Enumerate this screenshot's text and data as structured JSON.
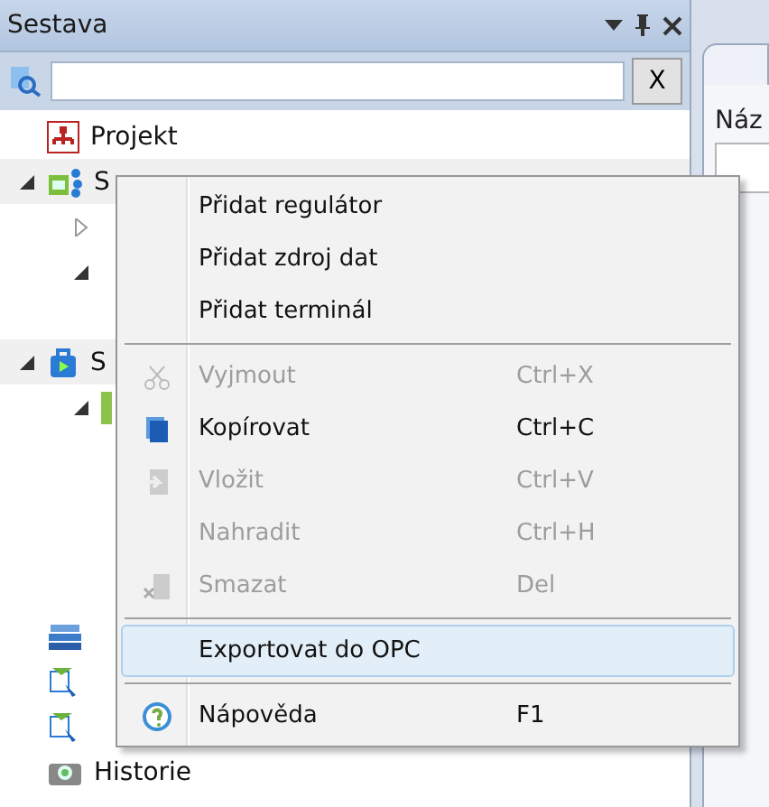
{
  "panel": {
    "title": "Sestava",
    "search": {
      "clear_button": "X"
    },
    "tree": [
      {
        "label": "Projekt"
      },
      {
        "label": "S",
        "expanded": true,
        "children": [
          {
            "expanded": false
          },
          {
            "expanded": true
          }
        ]
      },
      {
        "label": "S",
        "expanded": true,
        "children": [
          {
            "expanded": true
          }
        ]
      },
      {
        "kind": "node"
      },
      {
        "kind": "node"
      },
      {
        "kind": "node"
      },
      {
        "label": "Historie"
      }
    ]
  },
  "document": {
    "field_label": "Náz"
  },
  "context_menu": [
    {
      "kind": "item",
      "label": "Přidat regulátor",
      "disabled": false,
      "selected": false
    },
    {
      "kind": "item",
      "label": "Přidat zdroj dat",
      "disabled": false,
      "selected": false
    },
    {
      "kind": "item",
      "label": "Přidat terminál",
      "disabled": false,
      "selected": false
    },
    {
      "kind": "separator"
    },
    {
      "kind": "item",
      "label": "Vyjmout",
      "shortcut": "Ctrl+X",
      "disabled": true,
      "selected": false
    },
    {
      "kind": "item",
      "label": "Kopírovat",
      "shortcut": "Ctrl+C",
      "disabled": false,
      "selected": false
    },
    {
      "kind": "item",
      "label": "Vložit",
      "shortcut": "Ctrl+V",
      "disabled": true,
      "selected": false
    },
    {
      "kind": "item",
      "label": "Nahradit",
      "shortcut": "Ctrl+H",
      "disabled": true,
      "selected": false
    },
    {
      "kind": "item",
      "label": "Smazat",
      "shortcut": "Del",
      "disabled": true,
      "selected": false
    },
    {
      "kind": "separator"
    },
    {
      "kind": "item",
      "label": "Exportovat do OPC",
      "disabled": false,
      "selected": true
    },
    {
      "kind": "separator"
    },
    {
      "kind": "item",
      "label": "Nápověda",
      "shortcut": "F1",
      "disabled": false,
      "selected": false
    }
  ]
}
